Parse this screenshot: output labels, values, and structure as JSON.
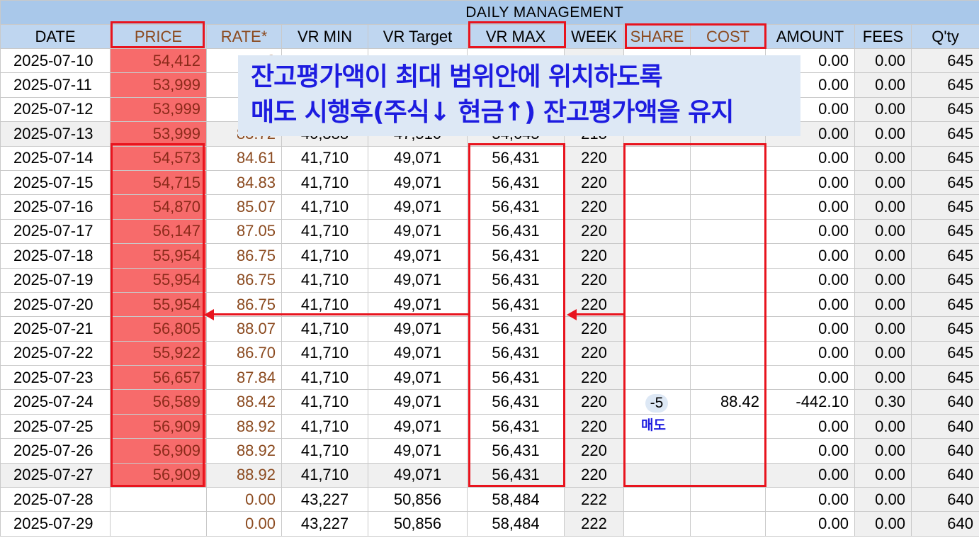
{
  "title": "DAILY MANAGEMENT",
  "columns": [
    "DATE",
    "PRICE",
    "RATE*",
    "VR MIN",
    "VR Target",
    "VR MAX",
    "WEEK",
    "SHARE",
    "COST",
    "AMOUNT",
    "FEES",
    "Q'ty"
  ],
  "rows": [
    {
      "date": "2025-07-10",
      "price": "54,412",
      "rate": "8",
      "vr_min": "",
      "vr_target": "",
      "vr_max": "",
      "week": "",
      "share": "",
      "cost": "",
      "amount": "0.00",
      "fees": "0.00",
      "qty": "645"
    },
    {
      "date": "2025-07-11",
      "price": "53,999",
      "rate": "8",
      "vr_min": "",
      "vr_target": "",
      "vr_max": "",
      "week": "",
      "share": "",
      "cost": "",
      "amount": "0.00",
      "fees": "0.00",
      "qty": "645"
    },
    {
      "date": "2025-07-12",
      "price": "53,999",
      "rate": "8",
      "vr_min": "",
      "vr_target": "",
      "vr_max": "",
      "week": "",
      "share": "",
      "cost": "",
      "amount": "0.00",
      "fees": "0.00",
      "qty": "645"
    },
    {
      "date": "2025-07-13",
      "price": "53,999",
      "rate": "83.72",
      "vr_min": "40,388",
      "vr_target": "47,510",
      "vr_max": "54,645",
      "week": "218",
      "share": "",
      "cost": "",
      "amount": "0.00",
      "fees": "0.00",
      "qty": "645"
    },
    {
      "date": "2025-07-14",
      "price": "54,573",
      "rate": "84.61",
      "vr_min": "41,710",
      "vr_target": "49,071",
      "vr_max": "56,431",
      "week": "220",
      "share": "",
      "cost": "",
      "amount": "0.00",
      "fees": "0.00",
      "qty": "645"
    },
    {
      "date": "2025-07-15",
      "price": "54,715",
      "rate": "84.83",
      "vr_min": "41,710",
      "vr_target": "49,071",
      "vr_max": "56,431",
      "week": "220",
      "share": "",
      "cost": "",
      "amount": "0.00",
      "fees": "0.00",
      "qty": "645"
    },
    {
      "date": "2025-07-16",
      "price": "54,870",
      "rate": "85.07",
      "vr_min": "41,710",
      "vr_target": "49,071",
      "vr_max": "56,431",
      "week": "220",
      "share": "",
      "cost": "",
      "amount": "0.00",
      "fees": "0.00",
      "qty": "645"
    },
    {
      "date": "2025-07-17",
      "price": "56,147",
      "rate": "87.05",
      "vr_min": "41,710",
      "vr_target": "49,071",
      "vr_max": "56,431",
      "week": "220",
      "share": "",
      "cost": "",
      "amount": "0.00",
      "fees": "0.00",
      "qty": "645"
    },
    {
      "date": "2025-07-18",
      "price": "55,954",
      "rate": "86.75",
      "vr_min": "41,710",
      "vr_target": "49,071",
      "vr_max": "56,431",
      "week": "220",
      "share": "",
      "cost": "",
      "amount": "0.00",
      "fees": "0.00",
      "qty": "645"
    },
    {
      "date": "2025-07-19",
      "price": "55,954",
      "rate": "86.75",
      "vr_min": "41,710",
      "vr_target": "49,071",
      "vr_max": "56,431",
      "week": "220",
      "share": "",
      "cost": "",
      "amount": "0.00",
      "fees": "0.00",
      "qty": "645"
    },
    {
      "date": "2025-07-20",
      "price": "55,954",
      "rate": "86.75",
      "vr_min": "41,710",
      "vr_target": "49,071",
      "vr_max": "56,431",
      "week": "220",
      "share": "",
      "cost": "",
      "amount": "0.00",
      "fees": "0.00",
      "qty": "645"
    },
    {
      "date": "2025-07-21",
      "price": "56,805",
      "rate": "88.07",
      "vr_min": "41,710",
      "vr_target": "49,071",
      "vr_max": "56,431",
      "week": "220",
      "share": "",
      "cost": "",
      "amount": "0.00",
      "fees": "0.00",
      "qty": "645"
    },
    {
      "date": "2025-07-22",
      "price": "55,922",
      "rate": "86.70",
      "vr_min": "41,710",
      "vr_target": "49,071",
      "vr_max": "56,431",
      "week": "220",
      "share": "",
      "cost": "",
      "amount": "0.00",
      "fees": "0.00",
      "qty": "645"
    },
    {
      "date": "2025-07-23",
      "price": "56,657",
      "rate": "87.84",
      "vr_min": "41,710",
      "vr_target": "49,071",
      "vr_max": "56,431",
      "week": "220",
      "share": "",
      "cost": "",
      "amount": "0.00",
      "fees": "0.00",
      "qty": "645"
    },
    {
      "date": "2025-07-24",
      "price": "56,589",
      "rate": "88.42",
      "vr_min": "41,710",
      "vr_target": "49,071",
      "vr_max": "56,431",
      "week": "220",
      "share": "",
      "cost": "88.42",
      "amount": "-442.10",
      "fees": "0.30",
      "qty": "640"
    },
    {
      "date": "2025-07-25",
      "price": "56,909",
      "rate": "88.92",
      "vr_min": "41,710",
      "vr_target": "49,071",
      "vr_max": "56,431",
      "week": "220",
      "share": "",
      "cost": "",
      "amount": "0.00",
      "fees": "0.00",
      "qty": "640"
    },
    {
      "date": "2025-07-26",
      "price": "56,909",
      "rate": "88.92",
      "vr_min": "41,710",
      "vr_target": "49,071",
      "vr_max": "56,431",
      "week": "220",
      "share": "",
      "cost": "",
      "amount": "0.00",
      "fees": "0.00",
      "qty": "640"
    },
    {
      "date": "2025-07-27",
      "price": "56,909",
      "rate": "88.92",
      "vr_min": "41,710",
      "vr_target": "49,071",
      "vr_max": "56,431",
      "week": "220",
      "share": "",
      "cost": "",
      "amount": "0.00",
      "fees": "0.00",
      "qty": "640"
    },
    {
      "date": "2025-07-28",
      "price": "",
      "rate": "0.00",
      "vr_min": "43,227",
      "vr_target": "50,856",
      "vr_max": "58,484",
      "week": "222",
      "share": "",
      "cost": "",
      "amount": "0.00",
      "fees": "0.00",
      "qty": "640"
    },
    {
      "date": "2025-07-29",
      "price": "",
      "rate": "0.00",
      "vr_min": "43,227",
      "vr_target": "50,856",
      "vr_max": "58,484",
      "week": "222",
      "share": "",
      "cost": "",
      "amount": "0.00",
      "fees": "0.00",
      "qty": "640"
    }
  ],
  "share_value": "-5",
  "sell_label": "매도",
  "callout": {
    "line1": "잔고평가액이 최대 범위안에 위치하도록",
    "line2": "매도 시행후(주식↓ 현금↑) 잔고평가액을 유지"
  },
  "colors": {
    "header_bg": "#bfd6f0",
    "title_bg": "#a9c8ea",
    "price_fill": "#f76b6b",
    "annotation_red": "#e8141e",
    "annotation_blue": "#1d1ce0"
  }
}
